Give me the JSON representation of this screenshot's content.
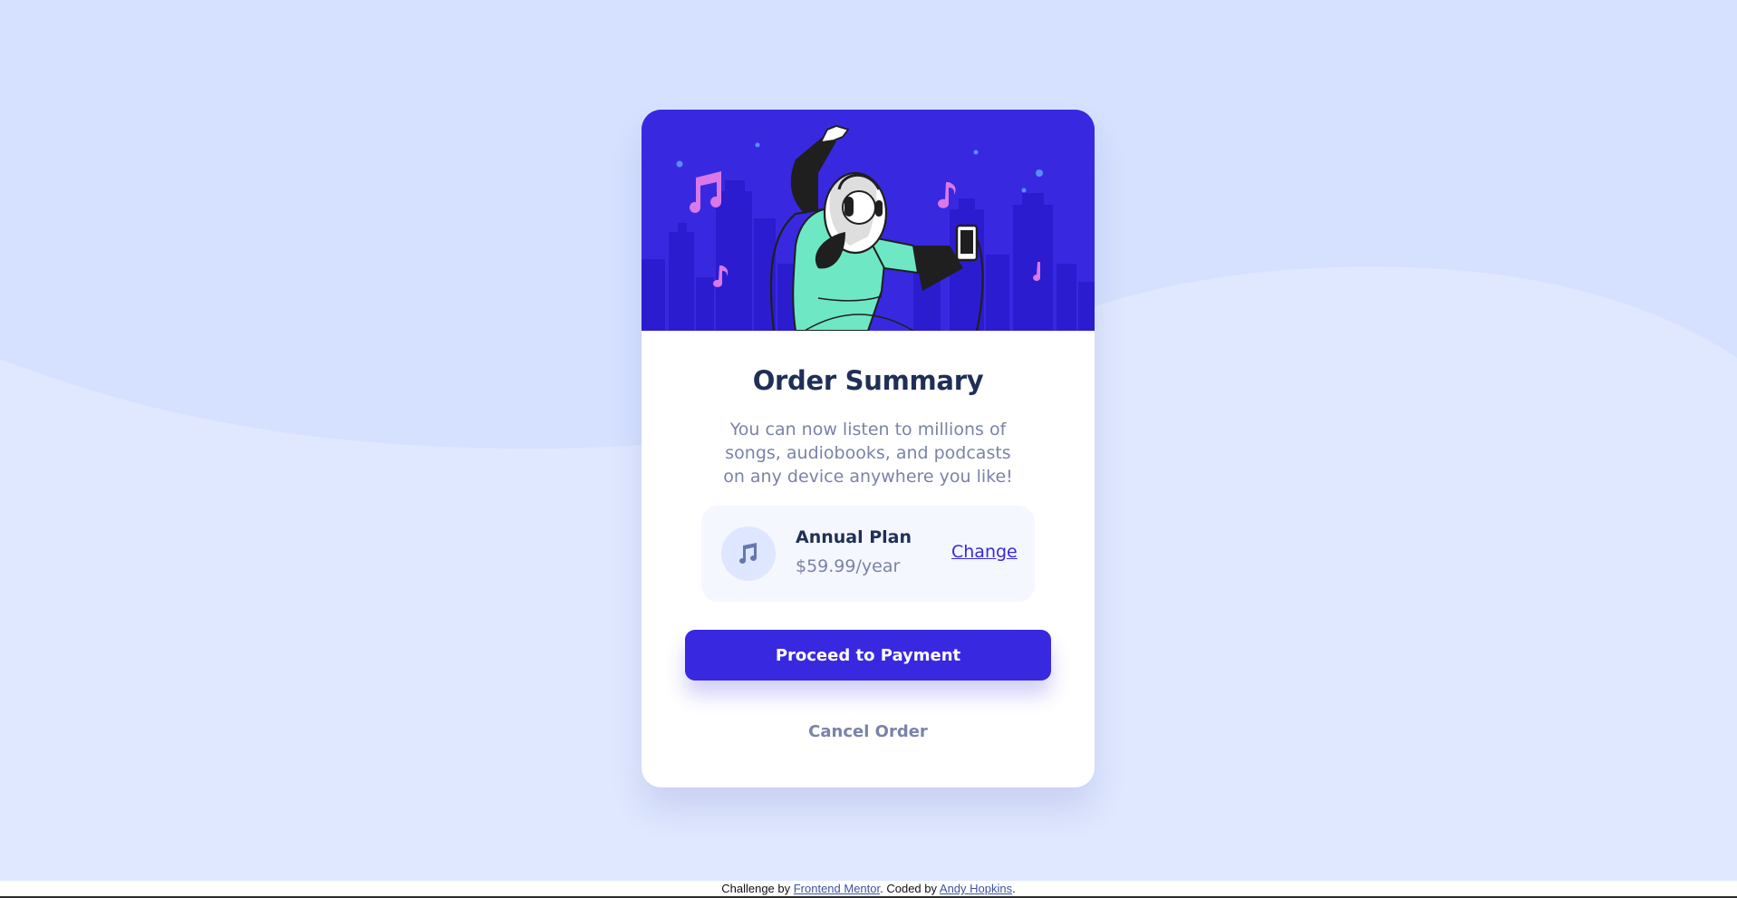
{
  "colors": {
    "page_bg": "#e0e8ff",
    "wave": "#d6e1ff",
    "bright_blue": "#3829e0",
    "dark_blue": "#1f2f56",
    "desaturated_blue": "#7a83a8",
    "pale_blue": "#f5f7ff"
  },
  "card": {
    "hero_image": "illustration-hero",
    "title": "Order Summary",
    "description": "You can now listen to millions of songs, audiobooks, and podcasts on any device anywhere you like!"
  },
  "plan": {
    "icon": "music-note-icon",
    "name": "Annual Plan",
    "price": "$59.99/year",
    "change_label": "Change"
  },
  "actions": {
    "proceed_label": "Proceed to Payment",
    "cancel_label": "Cancel Order"
  },
  "footer": {
    "prefix": "Challenge by ",
    "challenge_link": "Frontend Mentor",
    "middle": ". Coded by ",
    "author_link": "Andy Hopkins",
    "suffix": "."
  }
}
